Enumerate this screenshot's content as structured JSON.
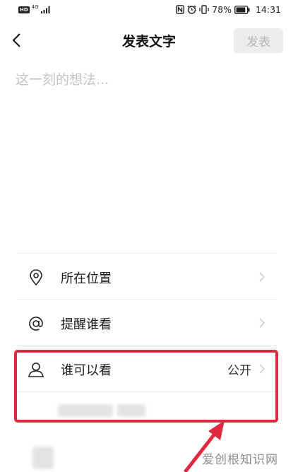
{
  "status_bar": {
    "hd": "HD",
    "network": "4G",
    "battery": "78%",
    "time": "14:31"
  },
  "nav": {
    "back_icon": "chevron-left-icon",
    "title": "发表文字",
    "publish_label": "发表"
  },
  "composer": {
    "placeholder": "这一刻的想法..."
  },
  "options": [
    {
      "label": "所在位置",
      "icon": "location-pin-icon",
      "value": ""
    },
    {
      "label": "提醒谁看",
      "icon": "at-sign-icon",
      "value": ""
    },
    {
      "label": "谁可以看",
      "icon": "person-icon",
      "value": "公开"
    }
  ],
  "annotation": {
    "highlight_color": "#e0293f"
  },
  "watermark": "爱创根知识网"
}
